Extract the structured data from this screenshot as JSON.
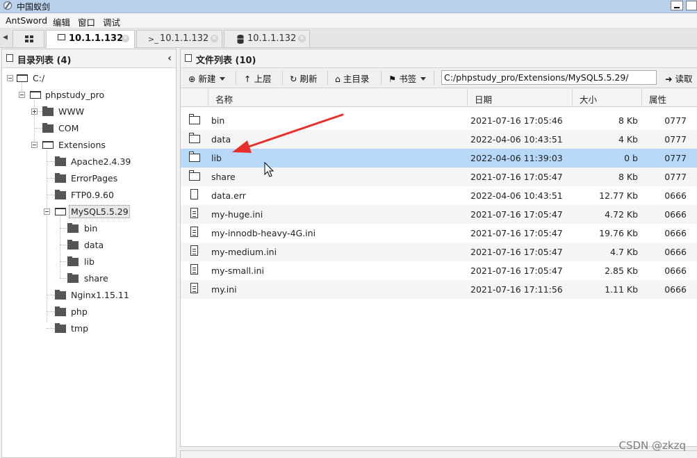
{
  "window": {
    "title": "中国蚁剑"
  },
  "menu": {
    "items": [
      "AntSword",
      "编辑",
      "窗口",
      "调试"
    ]
  },
  "tabs": [
    {
      "label": "10.1.1.132",
      "icon": "folder-icon",
      "active": true
    },
    {
      "label": "10.1.1.132",
      "icon": "terminal-icon",
      "active": false
    },
    {
      "label": "10.1.1.132",
      "icon": "database-icon",
      "active": false
    }
  ],
  "left_panel": {
    "title": "目录列表 (4)",
    "tree": {
      "root": "C:/",
      "phpstudy_pro": "phpstudy_pro",
      "www": "WWW",
      "com": "COM",
      "extensions": "Extensions",
      "apache": "Apache2.4.39",
      "errorpages": "ErrorPages",
      "ftp": "FTP0.9.60",
      "mysql": "MySQL5.5.29",
      "bin": "bin",
      "data": "data",
      "lib": "lib",
      "share": "share",
      "nginx": "Nginx1.15.11",
      "php": "php",
      "tmp": "tmp"
    }
  },
  "right_panel": {
    "title": "文件列表 (10)",
    "toolbar": {
      "new_label": "新建",
      "up_label": "上层",
      "refresh_label": "刷新",
      "home_label": "主目录",
      "bookmark_label": "书签",
      "path_value": "C:/phpstudy_pro/Extensions/MySQL5.5.29/",
      "read_label": "读取"
    },
    "columns": {
      "name": "名称",
      "date": "日期",
      "size": "大小",
      "attr": "属性"
    },
    "files": [
      {
        "name": "bin",
        "date": "2021-07-16 17:05:46",
        "size": "8 Kb",
        "attr": "0777",
        "icon": "folder-icon"
      },
      {
        "name": "data",
        "date": "2022-04-06 10:43:51",
        "size": "4 Kb",
        "attr": "0777",
        "icon": "folder-icon"
      },
      {
        "name": "lib",
        "date": "2022-04-06 11:39:03",
        "size": "0 b",
        "attr": "0777",
        "icon": "folder-icon",
        "selected": true
      },
      {
        "name": "share",
        "date": "2021-07-16 17:05:47",
        "size": "8 Kb",
        "attr": "0777",
        "icon": "folder-icon"
      },
      {
        "name": "data.err",
        "date": "2022-04-06 10:43:51",
        "size": "12.77 Kb",
        "attr": "0666",
        "icon": "file-icon"
      },
      {
        "name": "my-huge.ini",
        "date": "2021-07-16 17:05:47",
        "size": "4.72 Kb",
        "attr": "0666",
        "icon": "text-file-icon"
      },
      {
        "name": "my-innodb-heavy-4G.ini",
        "date": "2021-07-16 17:05:47",
        "size": "19.76 Kb",
        "attr": "0666",
        "icon": "text-file-icon"
      },
      {
        "name": "my-medium.ini",
        "date": "2021-07-16 17:05:47",
        "size": "4.7 Kb",
        "attr": "0666",
        "icon": "text-file-icon"
      },
      {
        "name": "my-small.ini",
        "date": "2021-07-16 17:05:47",
        "size": "2.85 Kb",
        "attr": "0666",
        "icon": "text-file-icon"
      },
      {
        "name": "my.ini",
        "date": "2021-07-16 17:11:56",
        "size": "1.11 Kb",
        "attr": "0666",
        "icon": "text-file-icon"
      }
    ]
  },
  "watermark": "CSDN @zkzq",
  "colors": {
    "selected_row": "#b8d8f8",
    "annotation_arrow": "#e8302a",
    "titlebar": "#b9d1ea"
  }
}
